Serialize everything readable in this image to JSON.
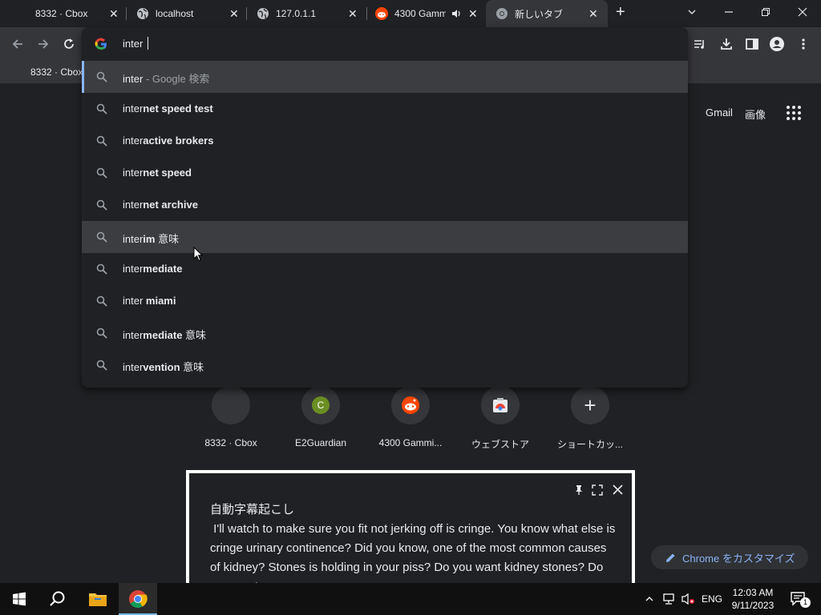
{
  "tabs": [
    {
      "title": "8332 · Cbox",
      "close": "✕"
    },
    {
      "title": "localhost",
      "close": "✕"
    },
    {
      "title": "127.0.1.1",
      "close": "✕"
    },
    {
      "title": "4300 Gamm",
      "close": "✕"
    },
    {
      "title": "新しいタブ",
      "close": "✕"
    }
  ],
  "new_tab": "+",
  "omnibox": {
    "value": "inter",
    "suggestions": [
      {
        "prefix": "inter",
        "bold": "",
        "suffix": " - Google 検索"
      },
      {
        "prefix": "inter",
        "bold": "net speed test",
        "suffix": ""
      },
      {
        "prefix": "inter",
        "bold": "active brokers",
        "suffix": ""
      },
      {
        "prefix": "inter",
        "bold": "net speed",
        "suffix": ""
      },
      {
        "prefix": "inter",
        "bold": "net archive",
        "suffix": ""
      },
      {
        "prefix": "inter",
        "bold": "im",
        "suffix": " 意味"
      },
      {
        "prefix": "inter",
        "bold": "mediate",
        "suffix": ""
      },
      {
        "prefix": "inter ",
        "bold": "miami",
        "suffix": ""
      },
      {
        "prefix": "inter",
        "bold": "mediate",
        "suffix": " 意味"
      },
      {
        "prefix": "inter",
        "bold": "vention",
        "suffix": " 意味"
      }
    ]
  },
  "bookmarks": [
    {
      "label": "8332 · Cbox"
    }
  ],
  "ntp_links": {
    "gmail": "Gmail",
    "images": "画像"
  },
  "shortcuts": [
    {
      "label": "8332 · Cbox",
      "glyph": ""
    },
    {
      "label": "E2Guardian",
      "glyph": "C"
    },
    {
      "label": "4300 Gammi...",
      "glyph": ""
    },
    {
      "label": "ウェブストア",
      "glyph": ""
    },
    {
      "label": "ショートカッ...",
      "glyph": "+"
    }
  ],
  "caption": {
    "title": "自動字幕起こし",
    "text": " I'll watch to make sure you fit not jerking off is cringe. You know what else is cringe urinary continence? Did you know, one of the most common causes of kidney? Stones is holding in your piss? Do you want kidney stones? Do you want."
  },
  "customize_label": "Chrome をカスタマイズ",
  "taskbar": {
    "lang": "ENG",
    "time": "12:03 AM",
    "date": "9/11/2023",
    "notif_count": "1"
  },
  "colors": {
    "accent": "#8ab4f8",
    "reddit": "#ff4500",
    "e2": "#6b8e23"
  }
}
